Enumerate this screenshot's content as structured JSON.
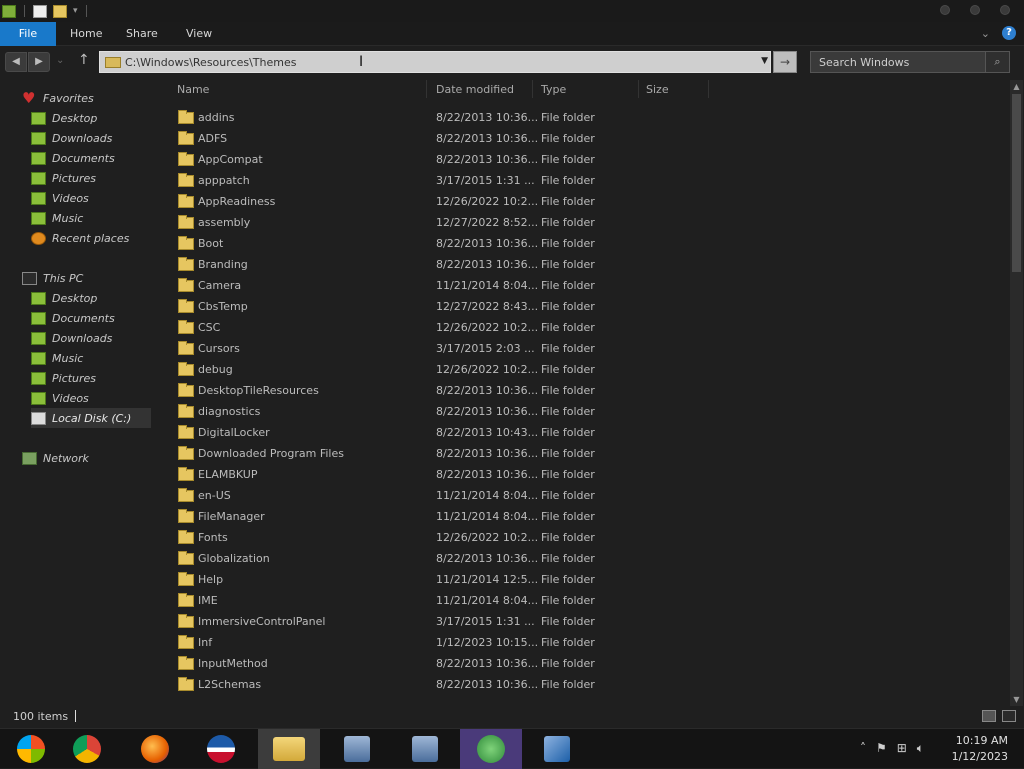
{
  "ribbon": {
    "tabs": [
      "File",
      "Home",
      "Share",
      "View"
    ]
  },
  "nav": {
    "address": "C:\\Windows\\Resources\\Themes",
    "search_placeholder": "Search Windows"
  },
  "sidebar": {
    "favorites_label": "Favorites",
    "favorites": [
      "Desktop",
      "Downloads",
      "Documents",
      "Pictures",
      "Videos",
      "Music",
      "Recent places"
    ],
    "thispc_label": "This PC",
    "thispc": [
      "Desktop",
      "Documents",
      "Downloads",
      "Music",
      "Pictures",
      "Videos",
      "Local Disk (C:)"
    ],
    "network_label": "Network"
  },
  "columns": [
    "Name",
    "Date modified",
    "Type",
    "Size"
  ],
  "files": [
    {
      "name": "addins",
      "date": "8/22/2013 10:36...",
      "type": "File folder"
    },
    {
      "name": "ADFS",
      "date": "8/22/2013 10:36...",
      "type": "File folder"
    },
    {
      "name": "AppCompat",
      "date": "8/22/2013 10:36...",
      "type": "File folder"
    },
    {
      "name": "apppatch",
      "date": "3/17/2015 1:31 ...",
      "type": "File folder"
    },
    {
      "name": "AppReadiness",
      "date": "12/26/2022 10:2...",
      "type": "File folder"
    },
    {
      "name": "assembly",
      "date": "12/27/2022 8:52...",
      "type": "File folder"
    },
    {
      "name": "Boot",
      "date": "8/22/2013 10:36...",
      "type": "File folder"
    },
    {
      "name": "Branding",
      "date": "8/22/2013 10:36...",
      "type": "File folder"
    },
    {
      "name": "Camera",
      "date": "11/21/2014 8:04...",
      "type": "File folder"
    },
    {
      "name": "CbsTemp",
      "date": "12/27/2022 8:43...",
      "type": "File folder"
    },
    {
      "name": "CSC",
      "date": "12/26/2022 10:2...",
      "type": "File folder"
    },
    {
      "name": "Cursors",
      "date": "3/17/2015 2:03 ...",
      "type": "File folder"
    },
    {
      "name": "debug",
      "date": "12/26/2022 10:2...",
      "type": "File folder"
    },
    {
      "name": "DesktopTileResources",
      "date": "8/22/2013 10:36...",
      "type": "File folder"
    },
    {
      "name": "diagnostics",
      "date": "8/22/2013 10:36...",
      "type": "File folder"
    },
    {
      "name": "DigitalLocker",
      "date": "8/22/2013 10:43...",
      "type": "File folder"
    },
    {
      "name": "Downloaded Program Files",
      "date": "8/22/2013 10:36...",
      "type": "File folder"
    },
    {
      "name": "ELAMBKUP",
      "date": "8/22/2013 10:36...",
      "type": "File folder"
    },
    {
      "name": "en-US",
      "date": "11/21/2014 8:04...",
      "type": "File folder"
    },
    {
      "name": "FileManager",
      "date": "11/21/2014 8:04...",
      "type": "File folder"
    },
    {
      "name": "Fonts",
      "date": "12/26/2022 10:2...",
      "type": "File folder"
    },
    {
      "name": "Globalization",
      "date": "8/22/2013 10:36...",
      "type": "File folder"
    },
    {
      "name": "Help",
      "date": "11/21/2014 12:5...",
      "type": "File folder"
    },
    {
      "name": "IME",
      "date": "11/21/2014 8:04...",
      "type": "File folder"
    },
    {
      "name": "ImmersiveControlPanel",
      "date": "3/17/2015 1:31 ...",
      "type": "File folder"
    },
    {
      "name": "Inf",
      "date": "1/12/2023 10:15...",
      "type": "File folder"
    },
    {
      "name": "InputMethod",
      "date": "8/22/2013 10:36...",
      "type": "File folder"
    },
    {
      "name": "L2Schemas",
      "date": "8/22/2013 10:36...",
      "type": "File folder"
    }
  ],
  "status": {
    "items": "100 items"
  },
  "clock": {
    "time": "10:19 AM",
    "date": "1/12/2023"
  },
  "taskbar": {
    "apps": [
      "windows-logo-icon",
      "chrome-icon",
      "firefox-icon",
      "obama-logo-icon",
      "file-explorer-icon",
      "setup-icon",
      "setup-icon-2",
      "messenger-icon",
      "virtualbox-icon"
    ]
  }
}
